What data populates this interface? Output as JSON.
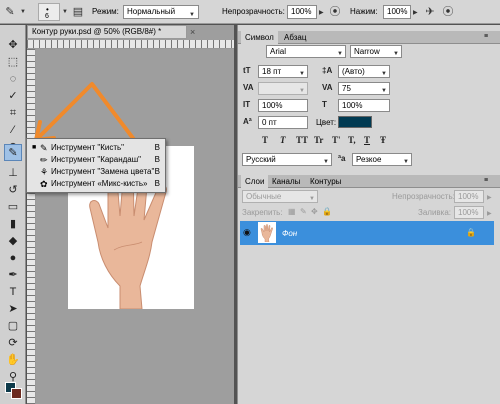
{
  "options_bar": {
    "brush_size": "6",
    "mode_label": "Режим:",
    "mode_value": "Нормальный",
    "opacity_label": "Непрозрачность:",
    "opacity_value": "100%",
    "flow_label": "Нажим:",
    "flow_value": "100%"
  },
  "document": {
    "tab_title": "Контур руки.psd @ 50% (RGB/8#) *",
    "close_glyph": "×"
  },
  "flyout": {
    "items": [
      {
        "label": "Инструмент \"Кисть\"",
        "key": "B",
        "bullet": "■",
        "icon": "✎"
      },
      {
        "label": "Инструмент \"Карандаш\"",
        "key": "B",
        "bullet": "",
        "icon": "✏"
      },
      {
        "label": "Инструмент \"Замена цвета\"",
        "key": "B",
        "bullet": "",
        "icon": "⚘"
      },
      {
        "label": "Инструмент «Микс-кисть»",
        "key": "B",
        "bullet": "",
        "icon": "✿"
      }
    ]
  },
  "character_panel": {
    "tab_symbol": "Символ",
    "tab_paragraph": "Абзац",
    "font_family": "Arial",
    "font_style": "Narrow",
    "font_size": "18 пт",
    "leading": "(Авто)",
    "tracking": "75",
    "vertical_scale": "100%",
    "horizontal_scale": "100%",
    "baseline_shift": "0 пт",
    "color_label": "Цвет:",
    "color_value": "#003a52",
    "style_buttons": [
      "T",
      "T",
      "TT",
      "Tr",
      "T'",
      "T,",
      "T",
      "Ŧ"
    ],
    "language": "Русский",
    "antialias": "Резкое"
  },
  "layers_panel": {
    "tab_layers": "Слои",
    "tab_channels": "Каналы",
    "tab_paths": "Контуры",
    "blend_mode": "Обычные",
    "opacity_label": "Непрозрачность:",
    "opacity_value": "100%",
    "lock_label": "Закрепить:",
    "fill_label": "Заливка:",
    "fill_value": "100%",
    "layer_name": "Фон"
  },
  "colors": {
    "selection": "#3b8fdc",
    "arrow": "#f08a2c",
    "foreground": "#0d3a4a",
    "background": "#6b2a20"
  }
}
